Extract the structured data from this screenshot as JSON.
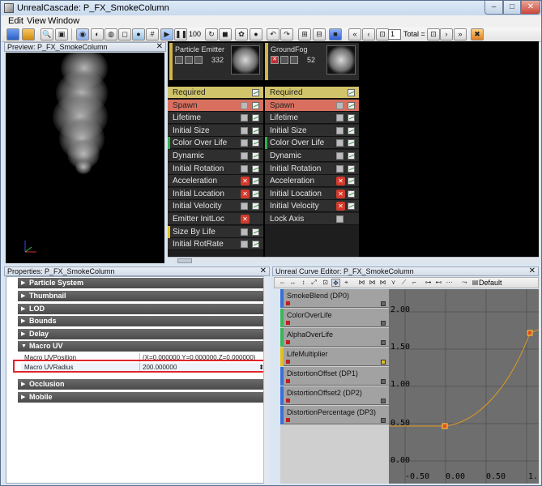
{
  "window": {
    "title": "UnrealCascade: P_FX_SmokeColumn"
  },
  "menu": [
    "Edit",
    "View",
    "Window"
  ],
  "toolbar": {
    "lod_value": "1",
    "total_label": "Total = 1",
    "zoom_label": "100"
  },
  "preview": {
    "title": "Preview: P_FX_SmokeColumn"
  },
  "emitters": [
    {
      "name": "Particle Emitter",
      "count": "332"
    },
    {
      "name": "GroundFog",
      "count": "52"
    }
  ],
  "modules_1": [
    {
      "label": "Required",
      "kind": "req",
      "mark": "graph"
    },
    {
      "label": "Spawn",
      "kind": "spawn",
      "mark": "chk"
    },
    {
      "label": "Lifetime",
      "kind": "norm",
      "mark": "chk"
    },
    {
      "label": "Initial Size",
      "kind": "norm",
      "mark": "chk"
    },
    {
      "label": "Color Over Life",
      "kind": "norm",
      "mark": "chk"
    },
    {
      "label": "Dynamic",
      "kind": "norm",
      "mark": "chk"
    },
    {
      "label": "Initial Rotation",
      "kind": "norm",
      "mark": "chk"
    },
    {
      "label": "Acceleration",
      "kind": "norm",
      "mark": "x"
    },
    {
      "label": "Initial Location",
      "kind": "norm",
      "mark": "x"
    },
    {
      "label": "Initial Velocity",
      "kind": "norm",
      "mark": "chk"
    },
    {
      "label": "Emitter InitLoc",
      "kind": "norm",
      "mark": "xonly"
    },
    {
      "label": "Size By Life",
      "kind": "norm",
      "mark": "chk"
    },
    {
      "label": "Initial RotRate",
      "kind": "norm",
      "mark": "chk"
    }
  ],
  "modules_2": [
    {
      "label": "Required",
      "kind": "req",
      "mark": "graph"
    },
    {
      "label": "Spawn",
      "kind": "spawn",
      "mark": "chk"
    },
    {
      "label": "Lifetime",
      "kind": "norm",
      "mark": "chk"
    },
    {
      "label": "Initial Size",
      "kind": "norm",
      "mark": "chk"
    },
    {
      "label": "Color Over Life",
      "kind": "norm",
      "mark": "chk"
    },
    {
      "label": "Dynamic",
      "kind": "norm",
      "mark": "chk"
    },
    {
      "label": "Initial Rotation",
      "kind": "norm",
      "mark": "chk"
    },
    {
      "label": "Acceleration",
      "kind": "norm",
      "mark": "x"
    },
    {
      "label": "Initial Location",
      "kind": "norm",
      "mark": "x"
    },
    {
      "label": "Initial Velocity",
      "kind": "norm",
      "mark": "x"
    },
    {
      "label": "Lock Axis",
      "kind": "norm",
      "mark": "chkonly"
    }
  ],
  "properties": {
    "title": "Properties: P_FX_SmokeColumn",
    "categories_top": [
      "Particle System",
      "Thumbnail",
      "LOD",
      "Bounds",
      "Delay"
    ],
    "macro_uv": "Macro UV",
    "macro_uv_position_label": "Macro UVPosition",
    "macro_uv_position_value": "(X=0.000000,Y=0.000000,Z=0.000000)",
    "macro_uv_radius_label": "Macro UVRadius",
    "macro_uv_radius_value": "200.000000",
    "categories_bottom": [
      "Occlusion",
      "Mobile"
    ]
  },
  "curve_editor": {
    "title": "Unreal Curve Editor: P_FX_SmokeColumn",
    "preset": "Default",
    "curves": [
      {
        "label": "SmokeBlend (DP0)",
        "color": "#3a6fd8"
      },
      {
        "label": "ColorOverLife",
        "color": "#3cb45a"
      },
      {
        "label": "AlphaOverLife",
        "color": "#3cb45a"
      },
      {
        "label": "LifeMultiplier",
        "color": "#e0c020"
      },
      {
        "label": "DistortionOffset (DP1)",
        "color": "#3a6fd8"
      },
      {
        "label": "DistortionOffset2 (DP2)",
        "color": "#3a6fd8"
      },
      {
        "label": "DistortionPercentage (DP3)",
        "color": "#3a6fd8"
      }
    ],
    "y_ticks": [
      "2.00",
      "1.50",
      "1.00",
      "0.50",
      "0.00"
    ],
    "x_ticks": [
      "-0.50",
      "0.00",
      "0.50",
      "1."
    ]
  }
}
